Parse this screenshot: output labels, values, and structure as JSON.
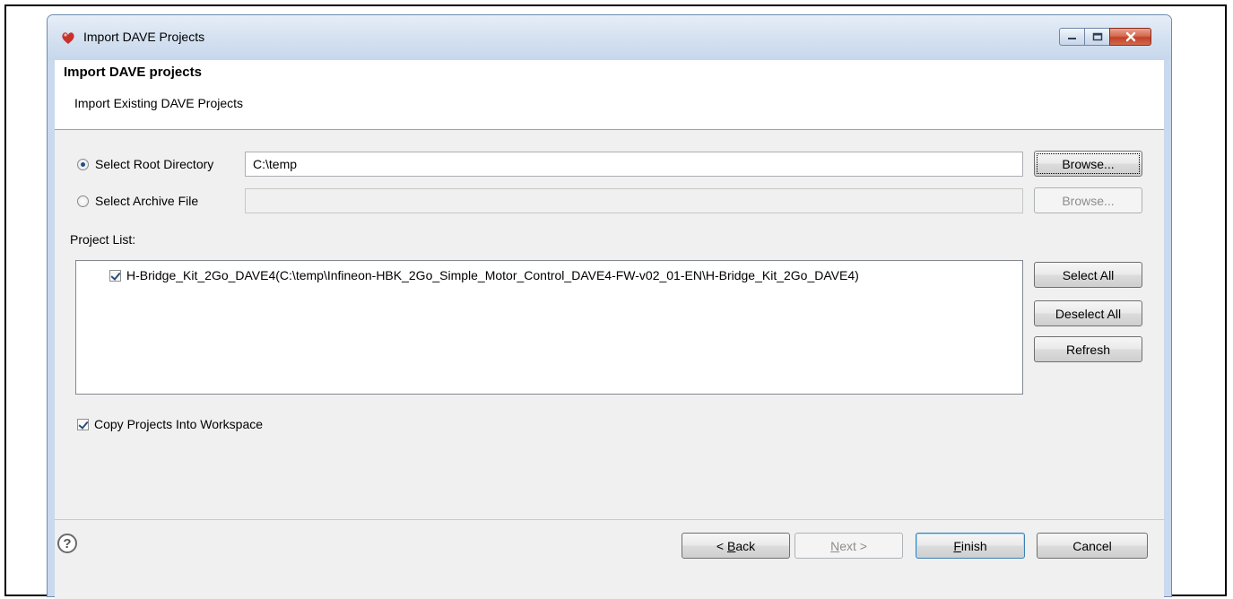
{
  "window": {
    "title": "Import DAVE Projects",
    "icons": {
      "app": "dave-app-icon",
      "minimize": "minimize-icon",
      "maximize": "maximize-icon",
      "close": "close-icon"
    },
    "colors": {
      "close_button": "#c7452c",
      "titlebar": "#d3e0f0"
    }
  },
  "header": {
    "title": "Import DAVE projects",
    "description": "Import Existing DAVE Projects"
  },
  "source": {
    "root_directory": {
      "label": "Select Root Directory",
      "selected": true,
      "value": "C:\\temp",
      "browse_label": "Browse..."
    },
    "archive_file": {
      "label": "Select Archive File",
      "selected": false,
      "value": "",
      "browse_label": "Browse..."
    }
  },
  "project_list": {
    "label": "Project List:",
    "items": [
      {
        "checked": true,
        "text": "H-Bridge_Kit_2Go_DAVE4(C:\\temp\\Infineon-HBK_2Go_Simple_Motor_Control_DAVE4-FW-v02_01-EN\\H-Bridge_Kit_2Go_DAVE4)"
      }
    ],
    "buttons": {
      "select_all": "Select All",
      "deselect_all": "Deselect All",
      "refresh": "Refresh"
    }
  },
  "options": {
    "copy_into_workspace": {
      "label": "Copy Projects Into Workspace",
      "checked": true
    }
  },
  "footer": {
    "help_icon": "help-icon",
    "help_glyph": "?",
    "back": {
      "prefix": "< ",
      "mnemonic": "B",
      "rest": "ack"
    },
    "next": {
      "mnemonic": "N",
      "rest": "ext >"
    },
    "finish": {
      "mnemonic": "F",
      "rest": "inish"
    },
    "cancel": "Cancel"
  }
}
